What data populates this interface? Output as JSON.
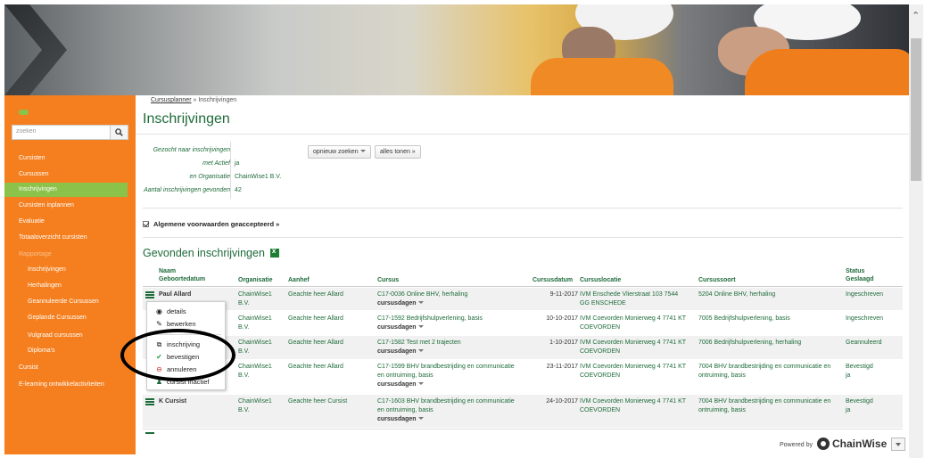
{
  "breadcrumb": {
    "link": "Cursusplanner",
    "sep": " » ",
    "current": "Inschrijvingen"
  },
  "page": {
    "title": "Inschrijvingen"
  },
  "sidebar": {
    "search_placeholder": "zoeken",
    "items": [
      {
        "label": "Cursisten",
        "type": "main"
      },
      {
        "label": "Cursussen",
        "type": "main"
      },
      {
        "label": "Inschrijvingen",
        "type": "active"
      },
      {
        "label": "Cursisten inplannen",
        "type": "main"
      },
      {
        "label": "Evaluatie",
        "type": "main"
      },
      {
        "label": "Totaaloverzicht cursisten",
        "type": "main"
      },
      {
        "label": "Rapportage",
        "type": "muted"
      },
      {
        "label": "Inschrijvingen",
        "type": "sub"
      },
      {
        "label": "Herhalingen",
        "type": "sub"
      },
      {
        "label": "Geannuleerde Cursussen",
        "type": "sub"
      },
      {
        "label": "Geplande Cursussen",
        "type": "sub"
      },
      {
        "label": "Vulgraad cursussen",
        "type": "sub"
      },
      {
        "label": "Diploma's",
        "type": "sub"
      },
      {
        "label": "Cursist",
        "type": "main"
      },
      {
        "label": "E-learning ontwikkelactiviteiten",
        "type": "main"
      }
    ]
  },
  "search_info": {
    "rows": [
      {
        "label": "Gezocht naar inschrijvingen",
        "value": ""
      },
      {
        "label": "met Actief",
        "value": "ja"
      },
      {
        "label": "en Organisatie",
        "value": "ChainWise1 B.V."
      },
      {
        "label": "Aantal inschrijvingen gevonden",
        "value": "42"
      }
    ],
    "btn_research": "opnieuw zoeken",
    "btn_showall": "alles tonen »"
  },
  "terms": {
    "label": "Algemene voorwaarden geaccepteerd »"
  },
  "results": {
    "title": "Gevonden inschrijvingen",
    "headers": {
      "naam": "Naam",
      "geboortedatum": "Geboortedatum",
      "organisatie": "Organisatie",
      "aanhef": "Aanhef",
      "cursus": "Cursus",
      "cursusdatum": "Cursusdatum",
      "cursuslocatie": "Cursuslocatie",
      "cursussoort": "Cursussoort",
      "status": "Status",
      "geslaagd": "Geslaagd"
    },
    "cursusdagen_label": "cursusdagen",
    "rows": [
      {
        "naam": "Paul Allard",
        "org1": "ChainWise1",
        "org2": "B.V.",
        "aanhef": "Geachte heer Allard",
        "cursus1": "C17-0036 Online BHV, herhaling",
        "cursus2": "",
        "datum": "9-11-2017",
        "loc1": "IVM Enschede Vlierstraat 103 7544",
        "loc2": "GG ENSCHEDE",
        "soort1": "5204 Online BHV, herhaling",
        "soort2": "",
        "status1": "Ingeschreven",
        "status2": ""
      },
      {
        "naam": "",
        "org1": "ChainWise1",
        "org2": "B.V.",
        "aanhef": "Geachte heer Allard",
        "cursus1": "C17-1592 Bedrijfshulpverlening, basis",
        "cursus2": "",
        "datum": "10-10-2017",
        "loc1": "IVM Coevorden Monierweg 4 7741 KT",
        "loc2": "COEVORDEN",
        "soort1": "7005 Bedrijfshulpverlening, basis",
        "soort2": "",
        "status1": "Ingeschreven",
        "status2": ""
      },
      {
        "naam": "",
        "org1": "ChainWise1",
        "org2": "B.V.",
        "aanhef": "Geachte heer Allard",
        "cursus1": "C17-1582 Test met 2 trajecten",
        "cursus2": "",
        "datum": "1-10-2017",
        "loc1": "IVM Coevorden Monierweg 4 7741 KT",
        "loc2": "COEVORDEN",
        "soort1": "7006 Bedrijfshulpverlening, herhaling",
        "soort2": "",
        "status1": "Geannuleerd",
        "status2": ""
      },
      {
        "naam": "",
        "org1": "ChainWise1",
        "org2": "B.V.",
        "aanhef": "Geachte heer Allard",
        "cursus1": "C17-1599 BHV brandbestrijding en communicatie",
        "cursus2": "en ontruiming, basis",
        "datum": "23-11-2017",
        "loc1": "IVM Coevorden Monierweg 4 7741 KT",
        "loc2": "COEVORDEN",
        "soort1": "7004 BHV brandbestrijding en communicatie en",
        "soort2": "ontruiming, basis",
        "status1": "Bevestigd",
        "status2": "ja"
      },
      {
        "naam": "K Cursist",
        "org1": "ChainWise1",
        "org2": "B.V.",
        "aanhef": "Geachte heer Cursist",
        "cursus1": "C17-1603 BHV brandbestrijding en communicatie",
        "cursus2": "en ontruiming, basis",
        "datum": "24-10-2017",
        "loc1": "IVM Coevorden Monierweg 4 7741 KT",
        "loc2": "COEVORDEN",
        "soort1": "7004 BHV brandbestrijding en communicatie en",
        "soort2": "ontruiming, basis",
        "status1": "Bevestigd",
        "status2": "ja"
      }
    ]
  },
  "context_menu": {
    "items": [
      {
        "label": "details",
        "icon": "eye-icon"
      },
      {
        "label": "bewerken",
        "icon": "edit-icon"
      },
      {
        "label": "inschrijving",
        "icon": "copy-icon"
      },
      {
        "label": "bevestigen",
        "icon": "check-icon"
      },
      {
        "label": "annuleren",
        "icon": "cancel-icon"
      },
      {
        "label": "cursist inactief",
        "icon": "user-icon"
      }
    ]
  },
  "footer": {
    "powered_by": "Powered by",
    "brand": "ChainWise"
  },
  "colors": {
    "sidebar": "#f57f1e",
    "active": "#8bc34a",
    "accent_green": "#1e6b3a"
  }
}
